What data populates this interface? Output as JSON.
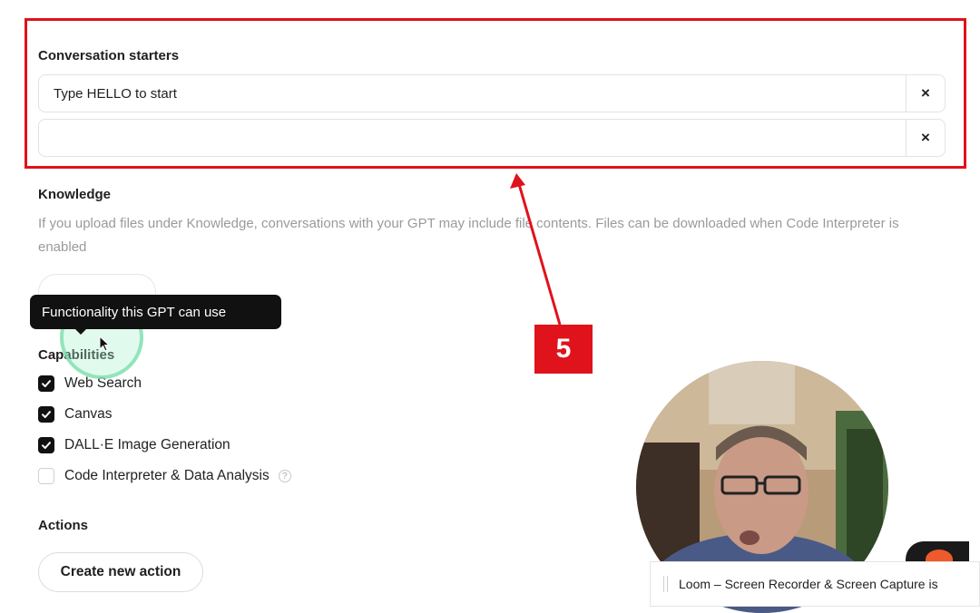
{
  "conversation_starters": {
    "title": "Conversation starters",
    "items": [
      {
        "value": "Type HELLO to start",
        "remove_icon": "×"
      },
      {
        "value": "",
        "remove_icon": "×"
      }
    ]
  },
  "knowledge": {
    "title": "Knowledge",
    "description": "If you upload files under Knowledge, conversations with your GPT may include file contents. Files can be downloaded when Code Interpreter is enabled"
  },
  "tooltip": {
    "text": "Functionality this GPT can use"
  },
  "capabilities": {
    "title": "Capabilities",
    "items": [
      {
        "label": "Web Search",
        "checked": true
      },
      {
        "label": "Canvas",
        "checked": true
      },
      {
        "label": "DALL·E Image Generation",
        "checked": true
      },
      {
        "label": "Code Interpreter & Data Analysis",
        "checked": false
      }
    ],
    "help_icon": "?"
  },
  "actions": {
    "title": "Actions",
    "create_label": "Create new action"
  },
  "annotation": {
    "badge": "5",
    "color": "#e0121b"
  },
  "loom": {
    "toast_text": "Loom – Screen Recorder & Screen Capture is"
  }
}
